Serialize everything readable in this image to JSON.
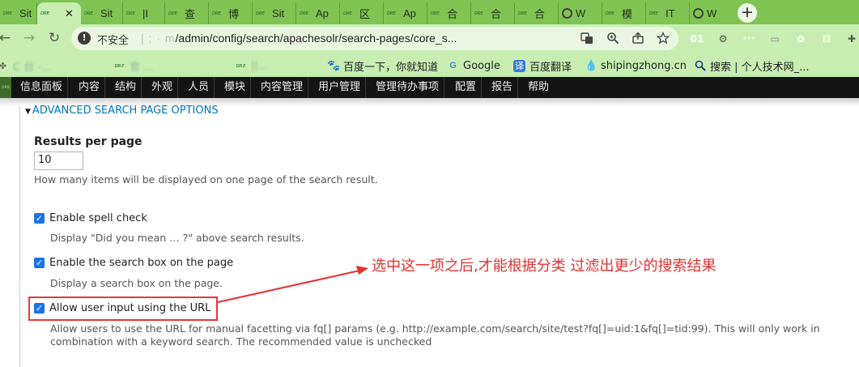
{
  "browser": {
    "tabs": [
      {
        "label": "Sit",
        "favicon": "site-favicon"
      },
      {
        "label": "",
        "favicon": "site-favicon",
        "active": true,
        "close": "✕"
      },
      {
        "label": "Sit",
        "favicon": "site-favicon"
      },
      {
        "label": "|I",
        "favicon": "site-favicon"
      },
      {
        "label": "查",
        "favicon": "site-favicon"
      },
      {
        "label": "博",
        "favicon": "site-favicon"
      },
      {
        "label": "Sit",
        "favicon": "site-favicon"
      },
      {
        "label": "Ap",
        "favicon": "site-favicon"
      },
      {
        "label": "区",
        "favicon": "site-favicon"
      },
      {
        "label": "Ap",
        "favicon": "site-favicon"
      },
      {
        "label": "合",
        "favicon": "site-favicon"
      },
      {
        "label": "合",
        "favicon": "site-favicon"
      },
      {
        "label": "合",
        "favicon": "site-favicon"
      },
      {
        "label": "W",
        "favicon": "globe-icon"
      },
      {
        "label": "模",
        "favicon": "site-favicon"
      },
      {
        "label": "IT",
        "favicon": "site-favicon"
      },
      {
        "label": "W",
        "favicon": "globe-icon"
      }
    ],
    "new_tab": "+",
    "favicon_text": "ᴅʀᴇ",
    "nav": {
      "back": "←",
      "forward": "→",
      "reload": "↻"
    },
    "omnibox": {
      "info_icon": "!",
      "insecure_label": "不安全",
      "url_blurred": "|  ;            ·           m",
      "url_visible": "/admin/config/search/apachesolr/search-pages/core_s...",
      "icons": [
        "translate-icon",
        "zoom-icon",
        "share-icon",
        "bookmark-star-icon"
      ]
    },
    "extensions": [
      {
        "name": "ext-01-icon",
        "text": "01",
        "color": "#111111"
      },
      {
        "name": "ext-gear-icon",
        "text": "⚙",
        "color": "#555555"
      },
      {
        "name": "ext-dots-icon",
        "text": "•••",
        "color": "#3c4a5c"
      },
      {
        "name": "ext-window-icon",
        "text": "▭",
        "color": "#d0d0d0"
      },
      {
        "name": "ext-orange-icon",
        "text": "✿",
        "color": "#f07a2a"
      },
      {
        "name": "ext-dice-icon",
        "text": "⚅",
        "color": "#e64a3c"
      },
      {
        "name": "ext-puzzle-icon",
        "text": "✚",
        "color": "#555555"
      }
    ],
    "bookmarks": [
      {
        "icon": "apps-icon",
        "label": "C        台 -...",
        "blurred": true
      },
      {
        "icon": "site-favicon",
        "label": "官      ...",
        "blurred": true
      },
      {
        "icon": "site-favicon",
        "label": "       ||...",
        "blurred": true
      },
      {
        "icon": "paw-icon",
        "label": "百度一下，你就知道"
      },
      {
        "icon": "google-icon",
        "label": "Google"
      },
      {
        "icon": "translate-icon",
        "label": "百度翻译"
      },
      {
        "icon": "drupal-icon",
        "label": "shipingzhong.cn"
      },
      {
        "icon": "search-icon",
        "label": "搜索 | 个人技术网_..."
      }
    ]
  },
  "admin_menu": {
    "items": [
      "信息面板",
      "内容",
      "结构",
      "外观",
      "人员",
      "模块",
      "内容管理",
      "用户管理",
      "管理待办事项",
      "配置",
      "报告",
      "帮助"
    ]
  },
  "content": {
    "section_title": "ADVANCED SEARCH PAGE OPTIONS",
    "section_toggle": "▼",
    "results_per_page": {
      "label": "Results per page",
      "value": "10",
      "description": "How many items will be displayed on one page of the search result."
    },
    "checkboxes": [
      {
        "label": "Enable spell check",
        "checked": true,
        "description": "Display \"Did you mean … ?\" above search results."
      },
      {
        "label": "Enable the search box on the page",
        "checked": true,
        "description": "Display a search box on the page."
      },
      {
        "label": "Allow user input using the URL",
        "checked": true,
        "description_line1": "Allow users to use the URL for manual facetting via fq[] params (e.g. http://example.com/search/site/test?fq[]=uid:1&fq[]=tid:99). This will only work in",
        "description_line2": "combination with a keyword search. The recommended value is unchecked"
      }
    ],
    "check_mark": "✓"
  },
  "annotation": {
    "text": "选中这一项之后,才能根据分类 过滤出更少的搜索结果",
    "color": "#e3322f"
  }
}
